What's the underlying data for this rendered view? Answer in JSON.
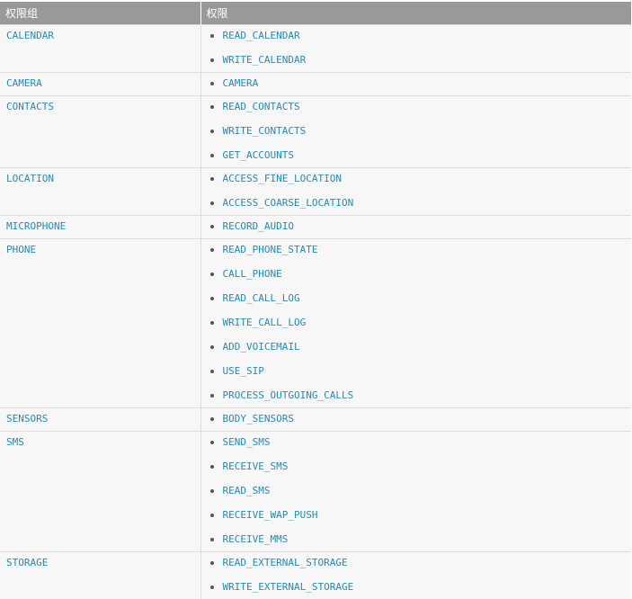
{
  "headers": {
    "group": "权限组",
    "permissions": "权限"
  },
  "colors": {
    "link": "#258aaf",
    "header_bg": "#999999",
    "row_bg": "#f7f7f7"
  },
  "rows": [
    {
      "group": "CALENDAR",
      "permissions": [
        "READ_CALENDAR",
        "WRITE_CALENDAR"
      ]
    },
    {
      "group": "CAMERA",
      "permissions": [
        "CAMERA"
      ]
    },
    {
      "group": "CONTACTS",
      "permissions": [
        "READ_CONTACTS",
        "WRITE_CONTACTS",
        "GET_ACCOUNTS"
      ]
    },
    {
      "group": "LOCATION",
      "permissions": [
        "ACCESS_FINE_LOCATION",
        "ACCESS_COARSE_LOCATION"
      ]
    },
    {
      "group": "MICROPHONE",
      "permissions": [
        "RECORD_AUDIO"
      ]
    },
    {
      "group": "PHONE",
      "permissions": [
        "READ_PHONE_STATE",
        "CALL_PHONE",
        "READ_CALL_LOG",
        "WRITE_CALL_LOG",
        "ADD_VOICEMAIL",
        "USE_SIP",
        "PROCESS_OUTGOING_CALLS"
      ]
    },
    {
      "group": "SENSORS",
      "permissions": [
        "BODY_SENSORS"
      ]
    },
    {
      "group": "SMS",
      "permissions": [
        "SEND_SMS",
        "RECEIVE_SMS",
        "READ_SMS",
        "RECEIVE_WAP_PUSH",
        "RECEIVE_MMS"
      ]
    },
    {
      "group": "STORAGE",
      "permissions": [
        "READ_EXTERNAL_STORAGE",
        "WRITE_EXTERNAL_STORAGE"
      ]
    }
  ]
}
